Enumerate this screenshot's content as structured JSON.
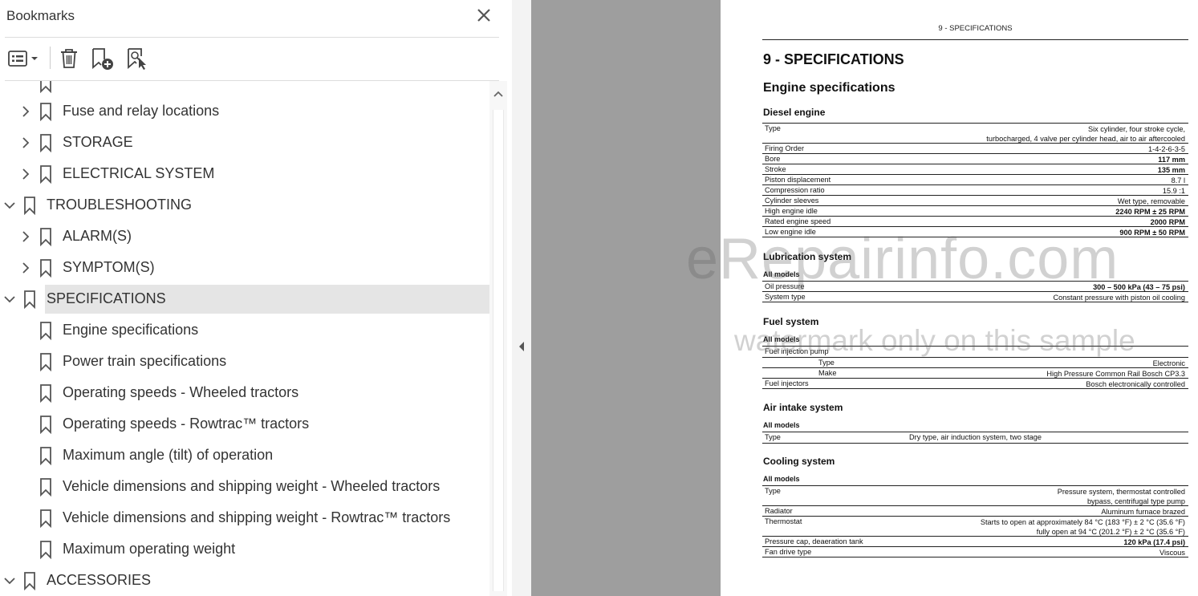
{
  "bookmarks_panel": {
    "title": "Bookmarks",
    "toolbar": {
      "options_icon": "list-options-icon",
      "delete_icon": "trash-icon",
      "new_bookmark_icon": "add-bookmark-icon",
      "find_bookmark_icon": "find-bookmark-icon"
    },
    "items": [
      {
        "label": "Fuse and relay locations",
        "level": 1,
        "expander": "collapsed"
      },
      {
        "label": "STORAGE",
        "level": 1,
        "expander": "collapsed"
      },
      {
        "label": "ELECTRICAL SYSTEM",
        "level": 1,
        "expander": "collapsed"
      },
      {
        "label": "TROUBLESHOOTING",
        "level": 0,
        "expander": "expanded"
      },
      {
        "label": "ALARM(S)",
        "level": 1,
        "expander": "collapsed"
      },
      {
        "label": "SYMPTOM(S)",
        "level": 1,
        "expander": "collapsed"
      },
      {
        "label": "SPECIFICATIONS",
        "level": 0,
        "expander": "expanded",
        "selected": true
      },
      {
        "label": "Engine specifications",
        "level": 1,
        "expander": "none"
      },
      {
        "label": "Power train specifications",
        "level": 1,
        "expander": "none"
      },
      {
        "label": "Operating speeds - Wheeled tractors",
        "level": 1,
        "expander": "none"
      },
      {
        "label": "Operating speeds - Rowtrac™ tractors",
        "level": 1,
        "expander": "none"
      },
      {
        "label": "Maximum angle (tilt) of operation",
        "level": 1,
        "expander": "none"
      },
      {
        "label": "Vehicle dimensions and shipping weight - Wheeled tractors",
        "level": 1,
        "expander": "none"
      },
      {
        "label": "Vehicle dimensions and shipping weight - Rowtrac™ tractors",
        "level": 1,
        "expander": "none"
      },
      {
        "label": "Maximum operating weight",
        "level": 1,
        "expander": "none"
      },
      {
        "label": "ACCESSORIES",
        "level": 0,
        "expander": "expanded"
      }
    ]
  },
  "document": {
    "running_head": "9 - SPECIFICATIONS",
    "chapter_title": "9 - SPECIFICATIONS",
    "section_title": "Engine specifications",
    "diesel": {
      "heading": "Diesel engine",
      "rows": [
        {
          "name": "Type",
          "value": "Six cylinder, four stroke cycle,",
          "value2": "turbocharged, 4 valve per cylinder head, air to air aftercooled"
        },
        {
          "name": "Firing Order",
          "value": "1-4-2-6-3-5"
        },
        {
          "name": "Bore",
          "value": "117 mm"
        },
        {
          "name": "Stroke",
          "value": "135 mm"
        },
        {
          "name": "Piston displacement",
          "value": "8.7 l"
        },
        {
          "name": "Compression ratio",
          "value": "15.9 :1"
        },
        {
          "name": "Cylinder sleeves",
          "value": "Wet type, removable"
        },
        {
          "name": "High engine idle",
          "value": "2240 RPM ± 25 RPM"
        },
        {
          "name": "Rated engine speed",
          "value": "2000 RPM"
        },
        {
          "name": "Low engine idle",
          "value": "900 RPM ± 50 RPM"
        }
      ]
    },
    "lubrication": {
      "heading": "Lubrication system",
      "all_models": "All models",
      "rows": [
        {
          "name": "Oil pressure",
          "value": "300 – 500 kPa (43 – 75 psi)"
        },
        {
          "name": "System type",
          "value": "Constant pressure with piston oil cooling"
        }
      ]
    },
    "fuel": {
      "heading": "Fuel system",
      "all_models": "All models",
      "pump_label": "Fuel injection pump",
      "rows": [
        {
          "name": "Type",
          "value": "Electronic"
        },
        {
          "name": "Make",
          "value": "High Pressure Common Rail Bosch CP3.3"
        },
        {
          "name": "Fuel injectors",
          "value": "Bosch electronically controlled"
        }
      ]
    },
    "air": {
      "heading": "Air intake system",
      "all_models": "All models",
      "rows": [
        {
          "name": "Type",
          "value": "Dry type, air induction system, two stage"
        }
      ]
    },
    "cooling": {
      "heading": "Cooling system",
      "all_models": "All models",
      "rows": [
        {
          "name": "Type",
          "value": "Pressure system, thermostat controlled",
          "value2": "bypass, centrifugal type pump"
        },
        {
          "name": "Radiator",
          "value": "Aluminum furnace brazed"
        },
        {
          "name": "Thermostat",
          "value": "Starts to open at approximately 84 °C (183 °F) ± 2 °C (35.6 °F)",
          "value2": "fully open at 94 °C (201.2 °F) ± 2 °C (35.6 °F)"
        },
        {
          "name": "Pressure cap, deaeration tank",
          "value": "120 kPa (17.4 psi)"
        },
        {
          "name": "Fan drive type",
          "value": "Viscous"
        }
      ]
    }
  },
  "watermark": {
    "line1": "eRepairinfo.com",
    "line2": "watermark only on this sample"
  }
}
